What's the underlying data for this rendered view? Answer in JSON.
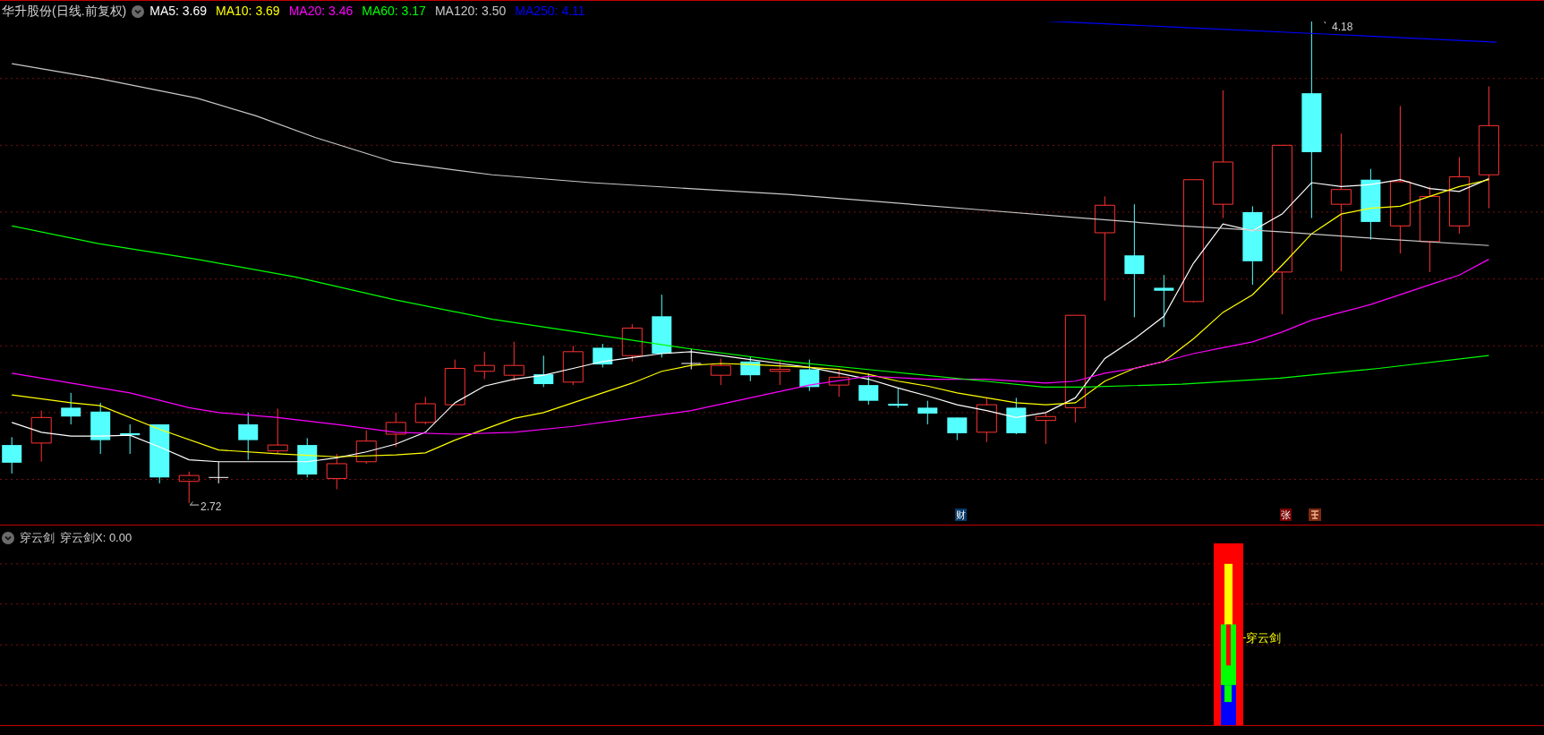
{
  "header": {
    "title": "华升股份(日线.前复权)",
    "ma_items": [
      {
        "label": "MA5: 3.69",
        "color": "#ffffff"
      },
      {
        "label": "MA10: 3.69",
        "color": "#ffff00"
      },
      {
        "label": "MA20: 3.46",
        "color": "#ff00ff"
      },
      {
        "label": "MA60: 3.17",
        "color": "#00ff00"
      },
      {
        "label": "MA120: 3.50",
        "color": "#c8c8c8"
      },
      {
        "label": "MA250: 4.11",
        "color": "#0000ff"
      }
    ]
  },
  "price_chart": {
    "high_label": "4.18",
    "low_label": "2.72",
    "markers": [
      {
        "text": "财",
        "color": "#0a3a6a"
      },
      {
        "text": "张",
        "color": "#7a0000"
      }
    ]
  },
  "indicator": {
    "name": "穿云剑",
    "value": "穿云剑X: 0.00",
    "signal_label": "穿云剑"
  }
}
